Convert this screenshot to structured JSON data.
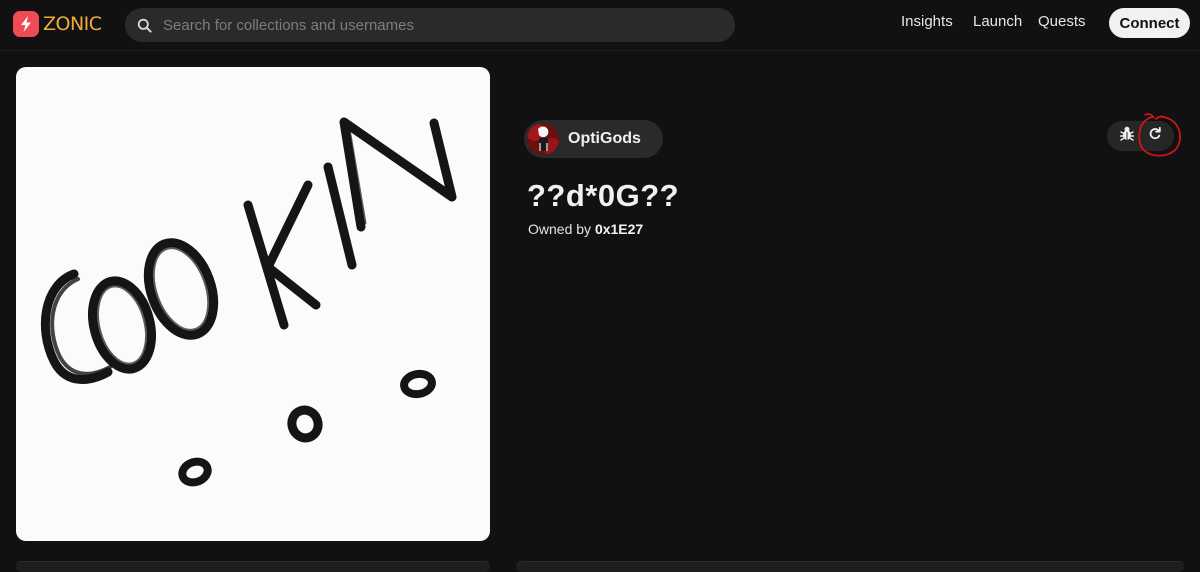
{
  "header": {
    "logo_text": "ZONIC",
    "search_placeholder": "Search for collections and usernames",
    "nav": [
      "Insights",
      "Launch",
      "Quests"
    ],
    "connect_label": "Connect"
  },
  "artwork": {
    "handwritten_text": "COOKIN"
  },
  "item": {
    "collection_name": "OptiGods",
    "token_name": "??d*0G??",
    "owner_prefix": "Owned by",
    "owner_address": "0x1E27"
  },
  "icons": {
    "logo": "lightning-bolt-icon",
    "search": "search-icon",
    "report": "bug-icon",
    "refresh": "refresh-icon"
  },
  "colors": {
    "background": "#111111",
    "brand_red": "#ef4b55",
    "brand_text": "#f2a93b",
    "annotation": "#d0141c"
  }
}
